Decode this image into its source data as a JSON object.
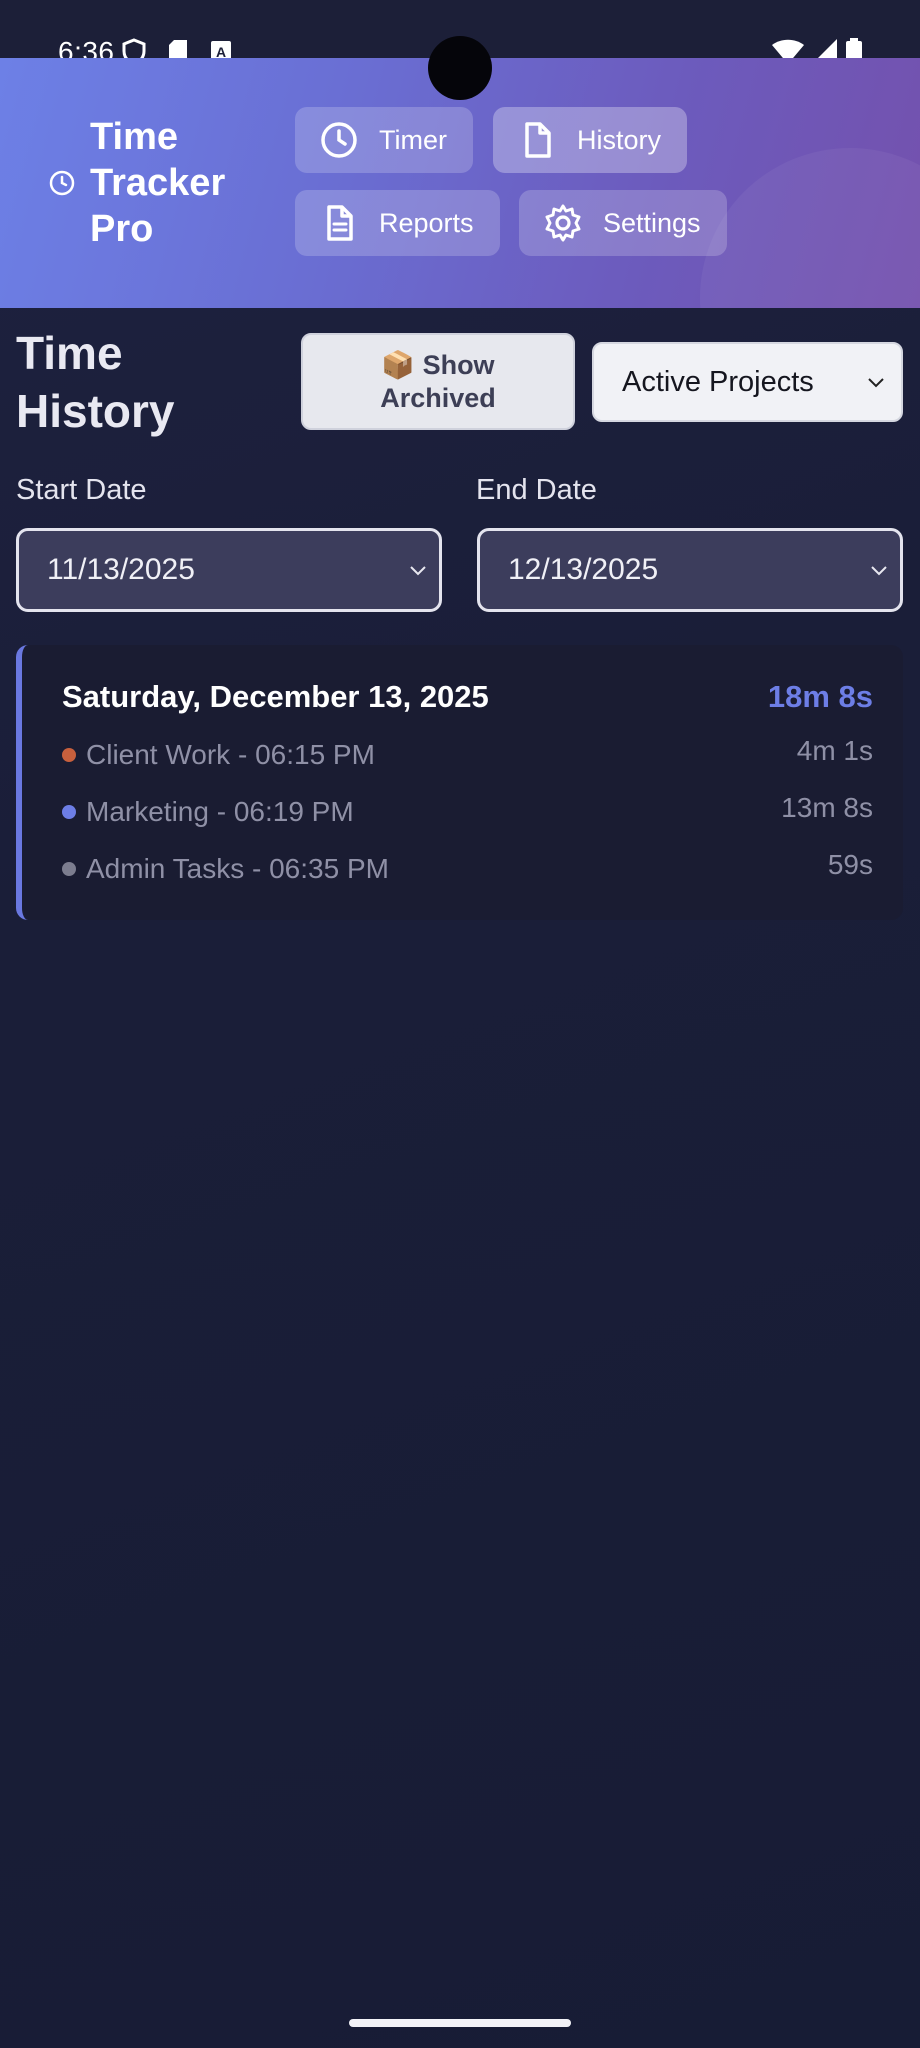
{
  "status_bar": {
    "time": "6:36"
  },
  "header": {
    "app_title": "Time Tracker Pro",
    "nav": [
      {
        "label": "Timer",
        "icon": "clock-icon",
        "active": false
      },
      {
        "label": "History",
        "icon": "file-icon",
        "active": true
      },
      {
        "label": "Reports",
        "icon": "document-icon",
        "active": false
      },
      {
        "label": "Settings",
        "icon": "gear-icon",
        "active": false
      }
    ]
  },
  "history": {
    "title": "Time History",
    "archive_button": {
      "emoji": "📦",
      "line1": "Show",
      "line2": "Archived"
    },
    "project_filter": {
      "selected": "Active Projects"
    },
    "start_date": {
      "label": "Start Date",
      "value": "11/13/2025"
    },
    "end_date": {
      "label": "End Date",
      "value": "12/13/2025"
    },
    "days": [
      {
        "date": "Saturday, December 13, 2025",
        "total": "18m 8s",
        "entries": [
          {
            "text": "Client Work - 06:15 PM",
            "duration": "4m 1s",
            "color": "#c8603d"
          },
          {
            "text": "Marketing - 06:19 PM",
            "duration": "13m 8s",
            "color": "#6d7ee6"
          },
          {
            "text": "Admin Tasks - 06:35 PM",
            "duration": "59s",
            "color": "#7c7d8f"
          }
        ]
      }
    ]
  },
  "colors": {
    "header_gradient_start": "#6d80e6",
    "header_gradient_end": "#7451ad",
    "accent": "#6d7ee6",
    "background": "#1b1f37"
  }
}
